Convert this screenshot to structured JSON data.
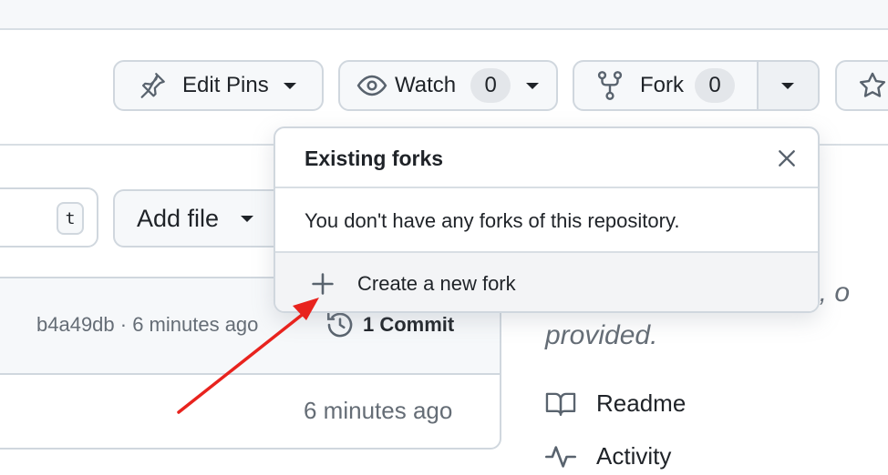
{
  "header_actions": {
    "edit_pins": {
      "label": "Edit Pins"
    },
    "watch": {
      "label": "Watch",
      "count": "0"
    },
    "fork": {
      "label": "Fork",
      "count": "0"
    }
  },
  "code_toolbar": {
    "search_shortcut": "t",
    "add_file": "Add file"
  },
  "latest_commit": {
    "info": "b4a49db · 6 minutes ago",
    "commits_link": "1 Commit"
  },
  "file_rows": [
    {
      "time": "6 minutes ago"
    }
  ],
  "about": {
    "line1": "site, o",
    "line2": "provided."
  },
  "sidebar_links": [
    {
      "label": "Readme",
      "icon": "book-icon"
    },
    {
      "label": "Activity",
      "icon": "pulse-icon"
    }
  ],
  "fork_dropdown": {
    "title": "Existing forks",
    "empty_message": "You don't have any forks of this repository.",
    "create_label": "Create a new fork"
  },
  "annotation": {
    "arrow_color": "#e8231e"
  }
}
